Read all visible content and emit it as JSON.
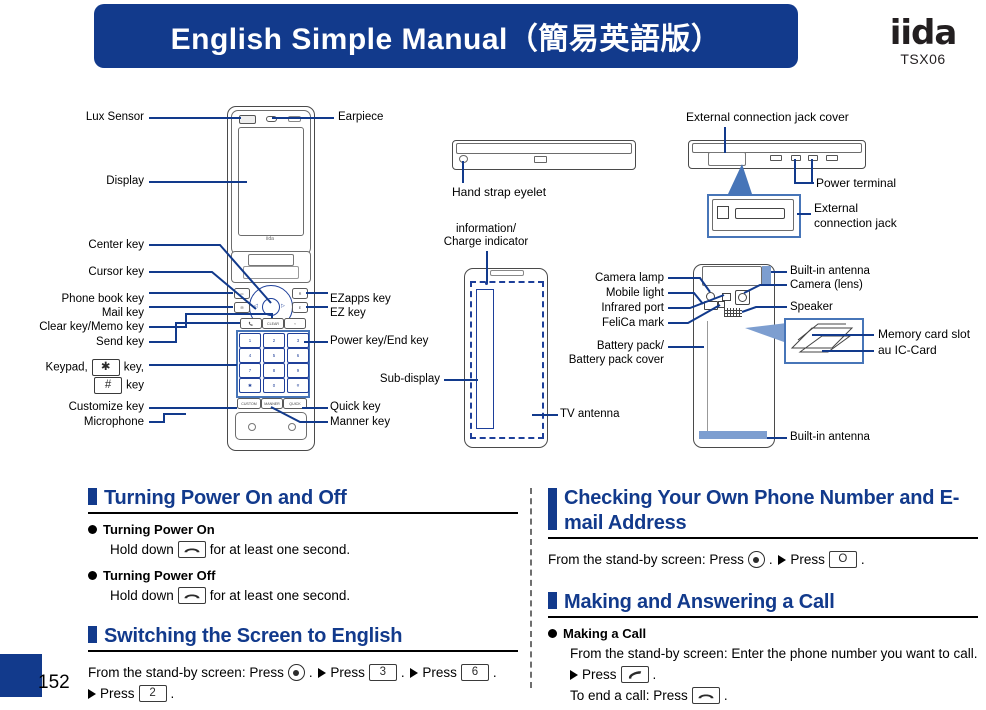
{
  "header": {
    "title": "English Simple Manual（簡易英語版）",
    "brand": "iida",
    "model": "TSX06",
    "band_color": "#123a8c"
  },
  "diagram": {
    "front_view_labels_left": [
      "Lux Sensor",
      "Display",
      "Center key",
      "Cursor key",
      "Phone book key",
      "Mail key",
      "Clear key/Memo key",
      "Send key",
      "Keypad,",
      "key,",
      "key",
      "Customize key",
      "Microphone"
    ],
    "front_view_labels_right": [
      "Earpiece",
      "EZapps key",
      "EZ key",
      "Power key/End key",
      "Quick key",
      "Manner key"
    ],
    "labels": {
      "lux_sensor": "Lux Sensor",
      "display": "Display",
      "center_key": "Center key",
      "cursor_key": "Cursor key",
      "phone_book_key": "Phone book key",
      "mail_key": "Mail key",
      "clear_memo_key": "Clear key/Memo key",
      "send_key": "Send key",
      "keypad_line1": "Keypad,",
      "keypad_line1b": "key,",
      "keypad_line2": "key",
      "customize_key": "Customize key",
      "microphone": "Microphone",
      "earpiece": "Earpiece",
      "ezapps_key": "EZapps key",
      "ez_key": "EZ key",
      "power_end_key": "Power key/End key",
      "quick_key": "Quick key",
      "manner_key": "Manner key",
      "hand_strap_eyelet": "Hand strap eyelet",
      "info_charge_indicator_l1": "information/",
      "info_charge_indicator_l2": "Charge indicator",
      "sub_display": "Sub-display",
      "tv_antenna": "TV antenna",
      "camera_lamp": "Camera lamp",
      "mobile_light": "Mobile light",
      "infrared_port": "Infrared port",
      "felica_mark": "FeliCa mark",
      "battery_pack_l1": "Battery pack/",
      "battery_pack_l2": "Battery pack cover",
      "ext_jack_cover": "External connection jack cover",
      "power_terminal": "Power terminal",
      "ext_jack_l1": "External",
      "ext_jack_l2": "connection jack",
      "builtin_antenna_top": "Built-in antenna",
      "camera_lens": "Camera (lens)",
      "speaker": "Speaker",
      "memory_card_slot": "Memory card slot",
      "au_ic_card": "au IC-Card",
      "builtin_antenna_bottom": "Built-in antenna"
    },
    "keypad_keys": [
      [
        "1",
        "2",
        "3"
      ],
      [
        "4",
        "5",
        "6"
      ],
      [
        "7",
        "8",
        "9"
      ],
      [
        "*",
        "0",
        "#"
      ]
    ],
    "display_brand": "iida",
    "line_color": "#123a8c"
  },
  "sections": {
    "left": [
      {
        "title": "Turning Power On and Off",
        "items": [
          {
            "type": "bullet",
            "text": "Turning Power On"
          },
          {
            "type": "step",
            "pre": "Hold down",
            "key": "power-end-key",
            "post": "for at least one second."
          },
          {
            "type": "bullet",
            "text": "Turning Power Off"
          },
          {
            "type": "step",
            "pre": "Hold down",
            "key": "power-end-key",
            "post": "for at least one second."
          }
        ]
      },
      {
        "title": "Switching the Screen to English",
        "items": [
          {
            "type": "sequence",
            "lead": "From the stand-by screen: Press",
            "steps": [
              {
                "key": "center-key",
                "label": ""
              },
              {
                "key": "numeric",
                "label": "3"
              },
              {
                "key": "numeric",
                "label": "6"
              },
              {
                "key": "numeric",
                "label": "2"
              }
            ],
            "press_word": "Press"
          }
        ]
      }
    ],
    "right": [
      {
        "title": "Checking Your Own Phone Number and E-mail Address",
        "items": [
          {
            "type": "sequence",
            "lead": "From the stand-by screen: Press",
            "steps": [
              {
                "key": "center-key",
                "label": ""
              },
              {
                "key": "numeric",
                "label": "O"
              }
            ],
            "press_word": "Press"
          }
        ]
      },
      {
        "title": "Making and Answering a Call",
        "items": [
          {
            "type": "bullet",
            "text": "Making a Call"
          },
          {
            "type": "text",
            "text": "From the stand-by screen: Enter the phone number you want to call."
          },
          {
            "type": "step_arrow",
            "pre": "Press",
            "key": "send-key",
            "post": "."
          },
          {
            "type": "step",
            "pre": "To end a call: Press",
            "key": "power-end-key",
            "post": "."
          }
        ]
      }
    ]
  },
  "footer": {
    "page_number": "152",
    "corner_color": "#123a8c"
  }
}
